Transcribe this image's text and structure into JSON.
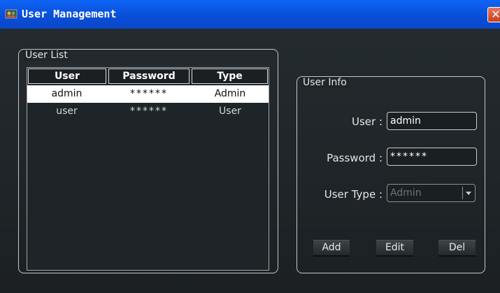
{
  "window": {
    "title": "User Management",
    "close_glyph": "✕"
  },
  "user_list": {
    "title": "User List",
    "columns": [
      "User",
      "Password",
      "Type"
    ],
    "rows": [
      {
        "user": "admin",
        "password": "******",
        "type": "Admin",
        "selected": true
      },
      {
        "user": "user",
        "password": "******",
        "type": "User",
        "selected": false
      }
    ]
  },
  "user_info": {
    "title": "User Info",
    "user_label": "User :",
    "user_value": "admin",
    "password_label": "Password :",
    "password_value": "******",
    "type_label": "User Type :",
    "type_value": "Admin",
    "buttons": {
      "add": "Add",
      "edit": "Edit",
      "del": "Del"
    }
  },
  "colors": {
    "titlebar": "#0a4fd8",
    "background": "#1c2225",
    "selection": "#ffffff"
  }
}
